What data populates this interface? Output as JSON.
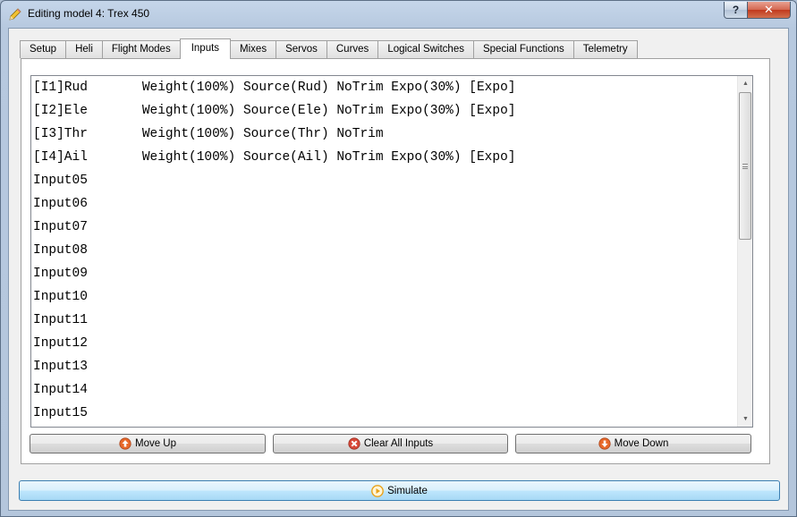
{
  "window": {
    "title": "Editing model 4: Trex 450",
    "help_label": "?",
    "close_label": "✕"
  },
  "tabs": [
    {
      "label": "Setup"
    },
    {
      "label": "Heli"
    },
    {
      "label": "Flight Modes"
    },
    {
      "label": "Inputs"
    },
    {
      "label": "Mixes"
    },
    {
      "label": "Servos"
    },
    {
      "label": "Curves"
    },
    {
      "label": "Logical Switches"
    },
    {
      "label": "Special Functions"
    },
    {
      "label": "Telemetry"
    }
  ],
  "active_tab": "Inputs",
  "inputs_list": [
    "[I1]Rud       Weight(100%) Source(Rud) NoTrim Expo(30%) [Expo]",
    "[I2]Ele       Weight(100%) Source(Ele) NoTrim Expo(30%) [Expo]",
    "[I3]Thr       Weight(100%) Source(Thr) NoTrim",
    "[I4]Ail       Weight(100%) Source(Ail) NoTrim Expo(30%) [Expo]",
    "Input05",
    "Input06",
    "Input07",
    "Input08",
    "Input09",
    "Input10",
    "Input11",
    "Input12",
    "Input13",
    "Input14",
    "Input15"
  ],
  "buttons": {
    "move_up": "Move Up",
    "clear_all": "Clear All Inputs",
    "move_down": "Move Down",
    "simulate": "Simulate"
  },
  "icons": {
    "title": "pencil-icon",
    "move_up": "arrow-up-circle-icon",
    "clear_all": "clear-x-circle-icon",
    "move_down": "arrow-down-circle-icon",
    "simulate": "play-circle-icon"
  },
  "colors": {
    "accent_orange": "#e8692a",
    "clear_red": "#d84a3a",
    "simulate_play": "#e9a21a"
  }
}
